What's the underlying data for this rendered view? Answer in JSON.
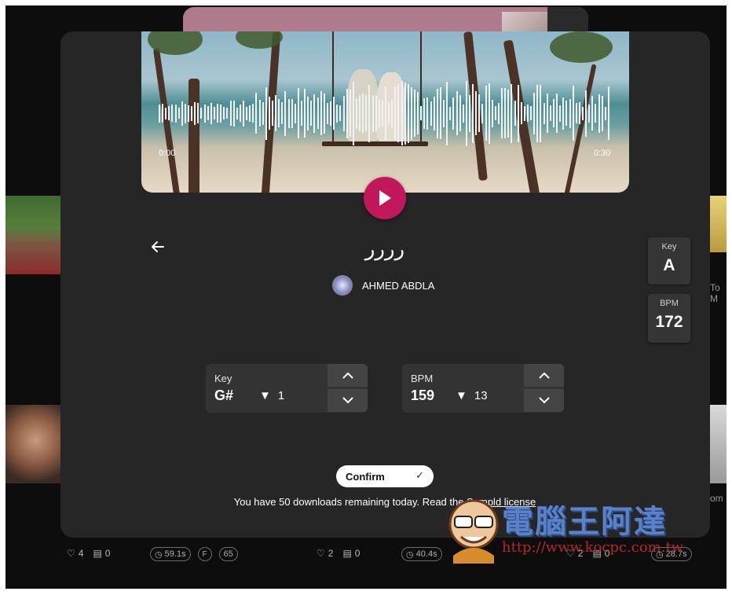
{
  "player": {
    "time_start": "0:00",
    "time_end": "0:30"
  },
  "sample": {
    "title": "رررر",
    "author": "AHMED ABDLA",
    "key_label": "Key",
    "key_value": "A",
    "bpm_label": "BPM",
    "bpm_value": "172"
  },
  "key_stepper": {
    "label": "Key",
    "value": "G#",
    "delta": "1"
  },
  "bpm_stepper": {
    "label": "BPM",
    "value": "159",
    "delta": "13"
  },
  "confirm": {
    "label": "Confirm"
  },
  "note": {
    "text": "You have 50 downloads remaining today. Read the",
    "link": "Sampld license"
  },
  "background": {
    "card1": {
      "likes": "4",
      "comments": "0",
      "duration": "59.1s",
      "badge": "F",
      "count": "65"
    },
    "card2": {
      "likes": "2",
      "comments": "0",
      "duration": "40.4s"
    },
    "card3": {
      "likes": "2",
      "comments": "0",
      "duration": "28.7s"
    },
    "right_text_1": "To M",
    "right_text_2": "om"
  },
  "watermark": {
    "text": "電腦王阿達",
    "url": "http://www.kocpc.com.tw"
  },
  "colors": {
    "modal_bg": "#262626",
    "play_accent": "#c2185b",
    "stepper_bg": "#333333"
  }
}
